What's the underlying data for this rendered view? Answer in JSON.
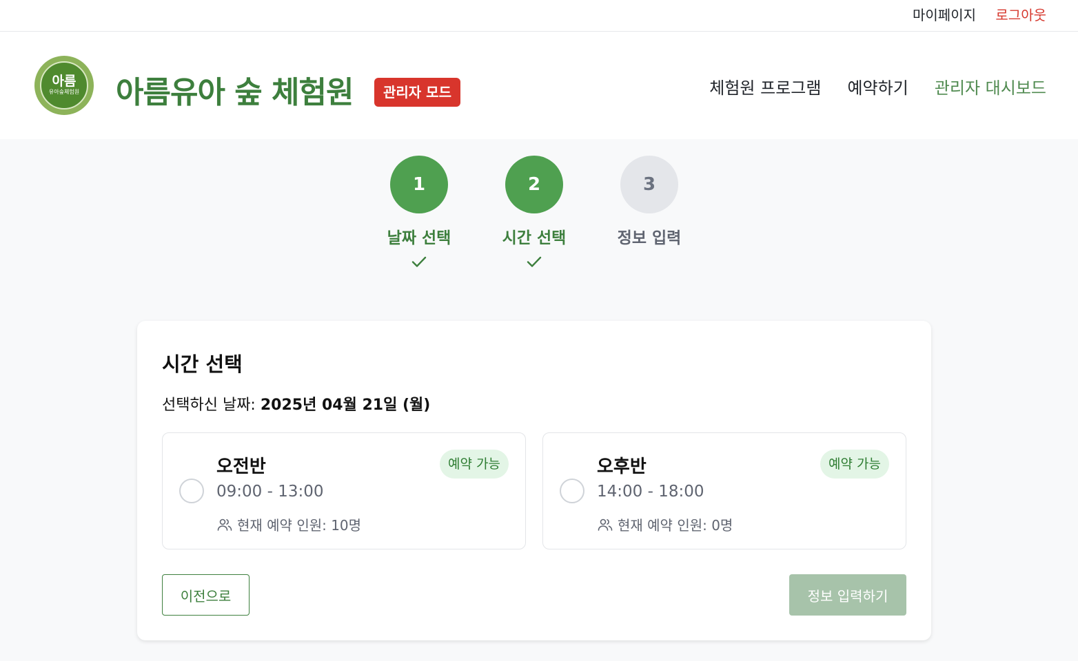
{
  "topbar": {
    "mypage": "마이페이지",
    "logout": "로그아웃"
  },
  "header": {
    "logo_main": "아름",
    "logo_sub": "유아숲체험원",
    "brand": "아름유아 숲 체험원",
    "admin_badge": "관리자 모드",
    "nav": [
      {
        "label": "체험원 프로그램"
      },
      {
        "label": "예약하기"
      },
      {
        "label": "관리자 대시보드"
      }
    ]
  },
  "steps": [
    {
      "number": "1",
      "label": "날짜 선택",
      "status": "done"
    },
    {
      "number": "2",
      "label": "시간 선택",
      "status": "done"
    },
    {
      "number": "3",
      "label": "정보 입력",
      "status": "todo"
    }
  ],
  "card": {
    "title": "시간 선택",
    "date_prefix": "선택하신 날짜: ",
    "date_value": "2025년 04월 21일 (월)",
    "slots": [
      {
        "name": "오전반",
        "time": "09:00 - 13:00",
        "count": "현재 예약 인원: 10명",
        "badge": "예약 가능"
      },
      {
        "name": "오후반",
        "time": "14:00 - 18:00",
        "count": "현재 예약 인원: 0명",
        "badge": "예약 가능"
      }
    ],
    "prev_button": "이전으로",
    "next_button": "정보 입력하기"
  },
  "colors": {
    "brand_green": "#3d7f3d",
    "step_done": "#4fa050",
    "admin_red": "#d8352c",
    "logout_red": "#d6382e",
    "disabled_button": "#a7c3aa",
    "available_badge_bg": "#e3f5e6"
  },
  "icons": [
    "check-icon",
    "users-icon",
    "radio-icon"
  ]
}
